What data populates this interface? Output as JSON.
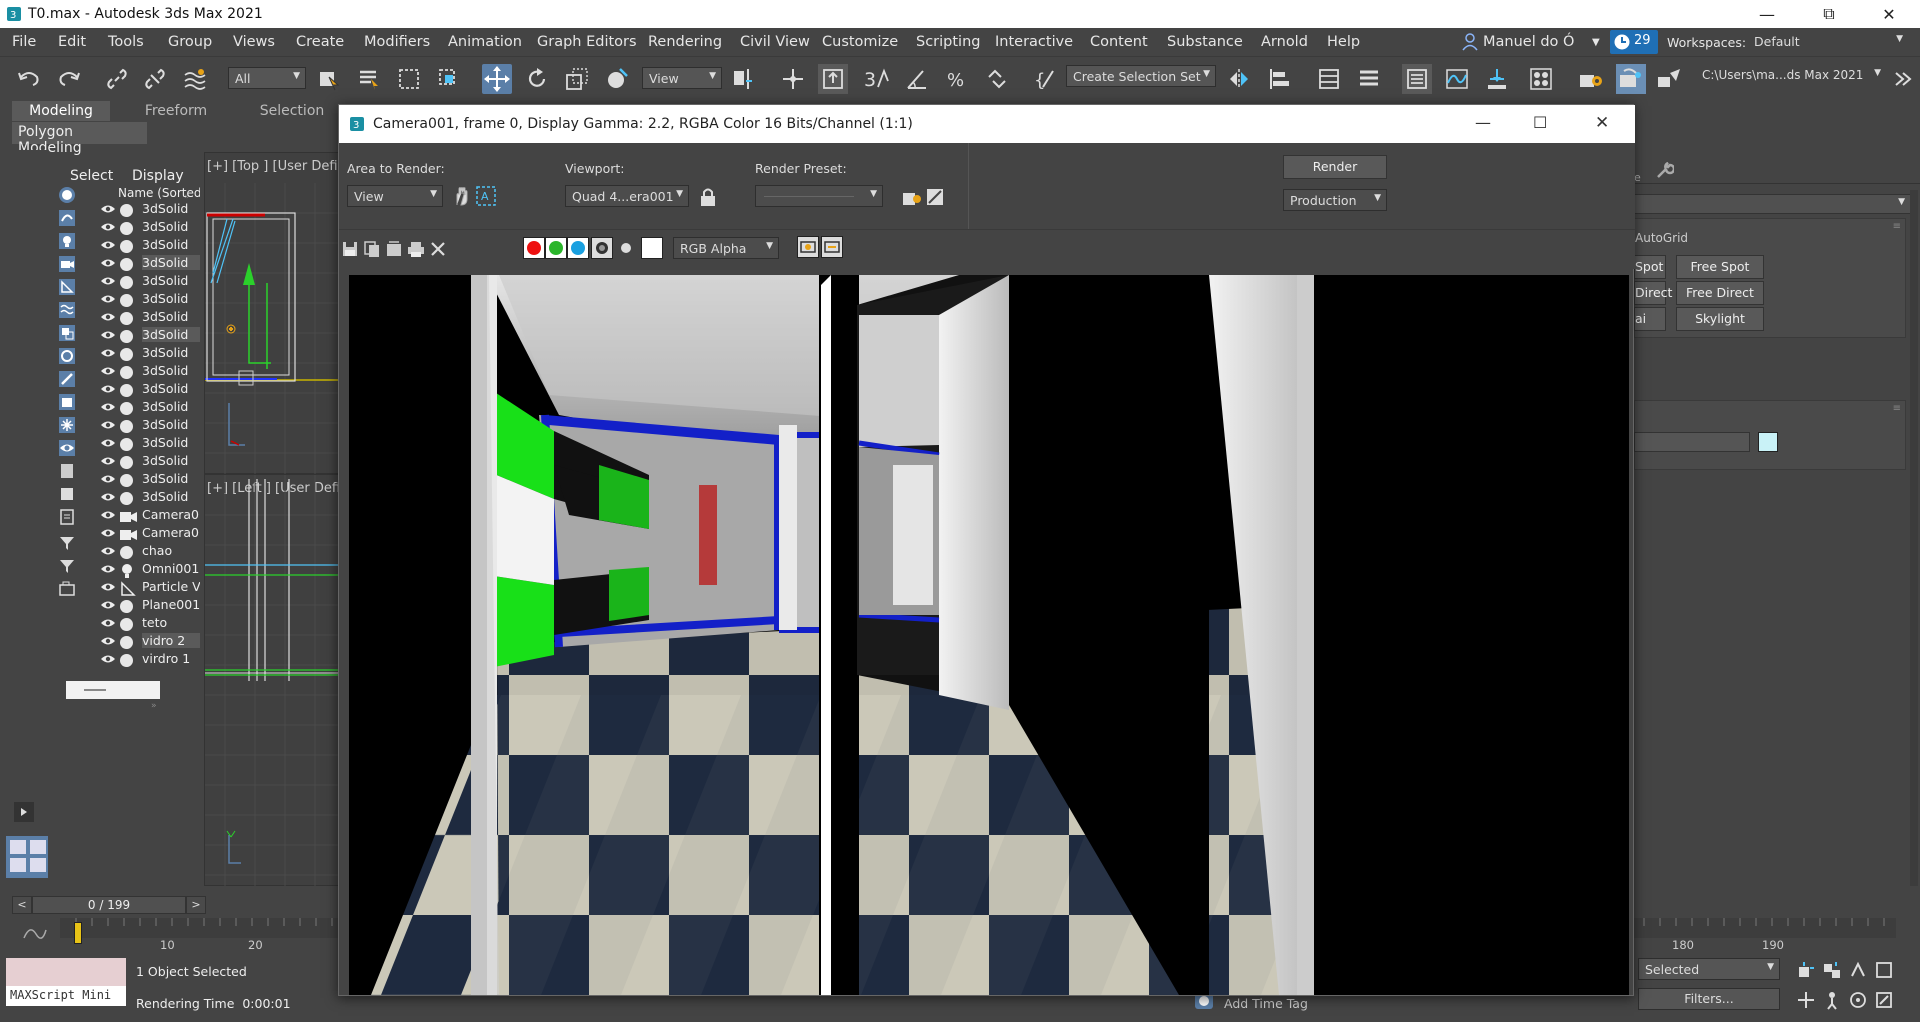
{
  "window": {
    "title": "T0.max - Autodesk 3ds Max 2021"
  },
  "menu": [
    "File",
    "Edit",
    "Tools",
    "Group",
    "Views",
    "Create",
    "Modifiers",
    "Animation",
    "Graph Editors",
    "Rendering",
    "Civil View",
    "Customize",
    "Scripting",
    "Interactive",
    "Content",
    "Substance",
    "Arnold",
    "Help"
  ],
  "user": {
    "name": "Manuel do Ó",
    "badge": "29",
    "workspaces_label": "Workspaces:",
    "workspace": "Default"
  },
  "toolbar": {
    "selection_filter": "All",
    "ref_coord": "View",
    "selection_set": "Create Selection Set",
    "project_path": "C:\\Users\\ma...ds Max 2021"
  },
  "ribbon": {
    "tabs": [
      "Modeling",
      "Freeform",
      "Selection"
    ],
    "sub": "Polygon Modeling"
  },
  "scene_explorer": {
    "tabs": [
      "Select",
      "Display"
    ],
    "column": "Name (Sorted Asce",
    "items": [
      {
        "name": "3dSolid",
        "type": "geo",
        "sel": false
      },
      {
        "name": "3dSolid",
        "type": "geo",
        "sel": false
      },
      {
        "name": "3dSolid",
        "type": "geo",
        "sel": false
      },
      {
        "name": "3dSolid",
        "type": "geo",
        "sel": true
      },
      {
        "name": "3dSolid",
        "type": "geo",
        "sel": false
      },
      {
        "name": "3dSolid",
        "type": "geo",
        "sel": false
      },
      {
        "name": "3dSolid",
        "type": "geo",
        "sel": false
      },
      {
        "name": "3dSolid",
        "type": "geo",
        "sel": true
      },
      {
        "name": "3dSolid",
        "type": "geo",
        "sel": false
      },
      {
        "name": "3dSolid",
        "type": "geo",
        "sel": false
      },
      {
        "name": "3dSolid",
        "type": "geo",
        "sel": false
      },
      {
        "name": "3dSolid",
        "type": "geo",
        "sel": false
      },
      {
        "name": "3dSolid",
        "type": "geo",
        "sel": false
      },
      {
        "name": "3dSolid",
        "type": "geo",
        "sel": false
      },
      {
        "name": "3dSolid",
        "type": "geo",
        "sel": false
      },
      {
        "name": "3dSolid",
        "type": "geo",
        "sel": false
      },
      {
        "name": "3dSolid",
        "type": "geo",
        "sel": false
      },
      {
        "name": "Camera0",
        "type": "camera",
        "sel": false
      },
      {
        "name": "Camera0",
        "type": "camera",
        "sel": false
      },
      {
        "name": "chao",
        "type": "geo",
        "sel": false
      },
      {
        "name": "Omni001",
        "type": "light",
        "sel": false
      },
      {
        "name": "Particle V",
        "type": "particle",
        "sel": false
      },
      {
        "name": "Plane001",
        "type": "geo",
        "sel": false
      },
      {
        "name": "teto",
        "type": "geo",
        "sel": false
      },
      {
        "name": "vidro 2",
        "type": "geo",
        "sel": true
      },
      {
        "name": "virdro 1",
        "type": "geo",
        "sel": false
      }
    ]
  },
  "viewports": {
    "top_label": "[+] [Top ] [User Defi",
    "left_label": "[+] [Left ] [User Defi"
  },
  "render_window": {
    "title": "Camera001, frame 0, Display Gamma: 2.2, RGBA Color 16 Bits/Channel (1:1)",
    "area_label": "Area to Render:",
    "area_value": "View",
    "viewport_label": "Viewport:",
    "viewport_value": "Quad 4...era001",
    "preset_label": "Render Preset:",
    "preset_value": "",
    "render_button": "Render",
    "production": "Production",
    "channel": "RGB Alpha"
  },
  "command_panel": {
    "autogrid": "AutoGrid",
    "buttons": [
      "Spot",
      "Free Spot",
      "Direct",
      "Free Direct",
      "ai",
      "Skylight"
    ]
  },
  "timeline": {
    "frame": "0 / 199",
    "ticks": [
      "10",
      "20",
      "180",
      "190"
    ]
  },
  "status": {
    "maxscript": "MAXScript Mini",
    "selected": "1 Object Selected",
    "render_time": "Rendering Time  0:00:01",
    "add_time_tag": "Add Time Tag",
    "sel_dropdown": "Selected",
    "filters": "Filters..."
  }
}
